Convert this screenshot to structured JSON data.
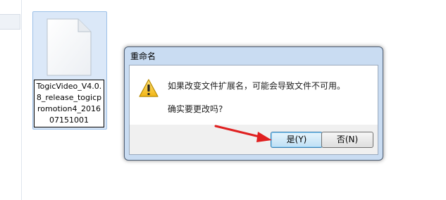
{
  "explorer": {
    "file_name": "TogicVideo_V4.0.8_release_togicpromotion4_201607151001",
    "icon": "blank-document-icon"
  },
  "dialog": {
    "title": "重命名",
    "message": "如果改变文件扩展名，可能会导致文件不可用。",
    "question": "确实要更改吗?",
    "yes_label": "是(Y)",
    "no_label": "否(N)",
    "icon": "warning-icon"
  },
  "colors": {
    "dialog_frame": "#c9dcf2",
    "selection": "#dbe8f8",
    "annotation_arrow": "#e02020"
  }
}
